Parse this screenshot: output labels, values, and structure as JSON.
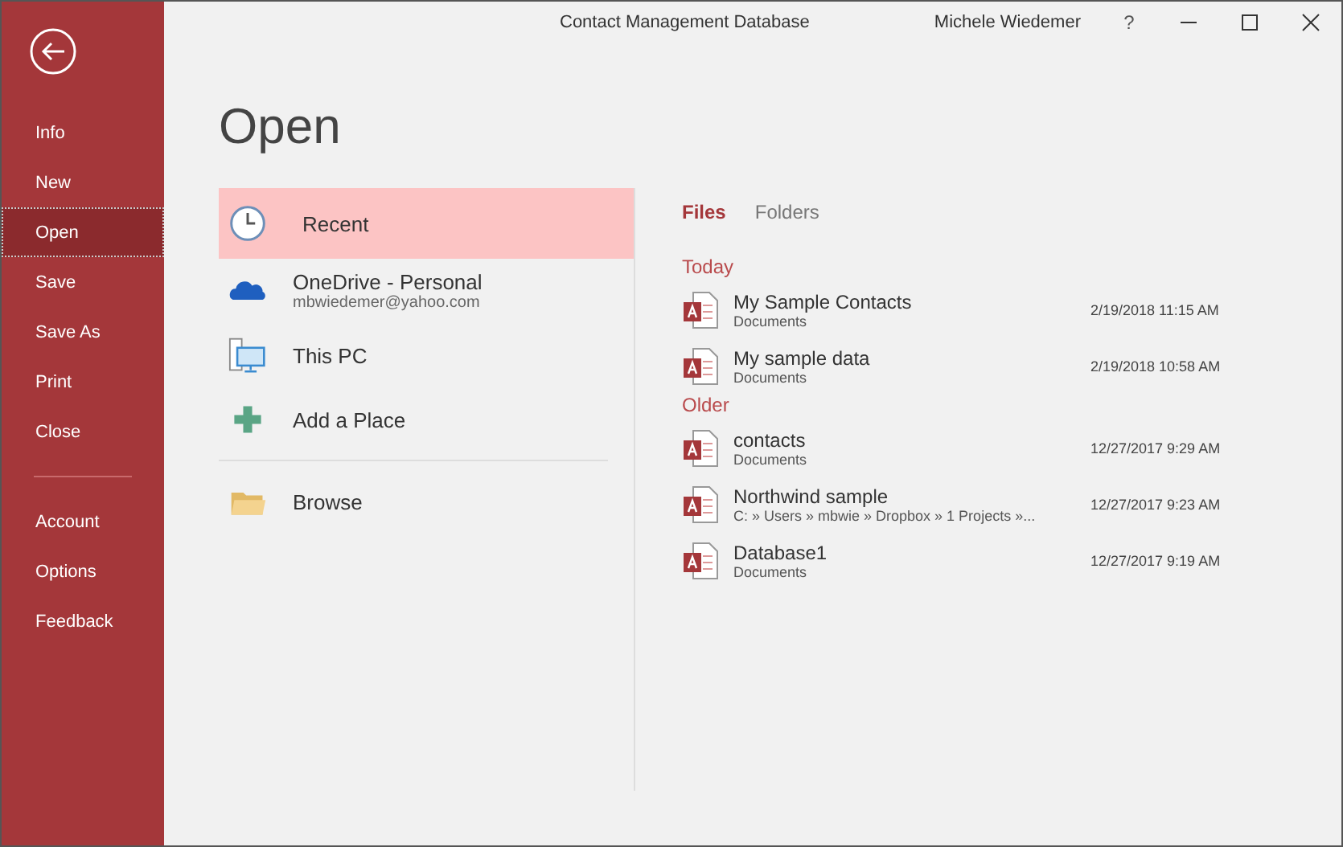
{
  "window": {
    "title": "Contact Management Database",
    "user": "Michele Wiedemer",
    "help": "?"
  },
  "sidebar": {
    "groups": [
      {
        "items": [
          {
            "label": "Info",
            "selected": false
          },
          {
            "label": "New",
            "selected": false
          },
          {
            "label": "Open",
            "selected": true
          },
          {
            "label": "Save",
            "selected": false
          },
          {
            "label": "Save As",
            "selected": false
          },
          {
            "label": "Print",
            "selected": false
          },
          {
            "label": "Close",
            "selected": false
          }
        ]
      },
      {
        "items": [
          {
            "label": "Account",
            "selected": false
          },
          {
            "label": "Options",
            "selected": false
          },
          {
            "label": "Feedback",
            "selected": false
          }
        ]
      }
    ]
  },
  "heading": "Open",
  "places": {
    "groups": [
      {
        "items": [
          {
            "kind": "clock",
            "label": "Recent",
            "selected": true
          },
          {
            "kind": "cloud",
            "label": "OneDrive - Personal",
            "detail": "mbwiedemer@yahoo.com",
            "selected": false
          },
          {
            "kind": "pc",
            "label": "This PC",
            "selected": false
          },
          {
            "kind": "plus",
            "label": "Add a Place",
            "selected": false
          }
        ]
      },
      {
        "items": [
          {
            "kind": "folder",
            "label": "Browse",
            "selected": false
          }
        ]
      }
    ]
  },
  "tabs": [
    {
      "label": "Files",
      "selected": true
    },
    {
      "label": "Folders",
      "selected": false
    }
  ],
  "sections": [
    {
      "title": "Today",
      "files": [
        {
          "name": "My Sample Contacts",
          "location": "Documents",
          "date": "2/19/2018 11:15 AM"
        },
        {
          "name": "My sample data",
          "location": "Documents",
          "date": "2/19/2018 10:58 AM"
        }
      ]
    },
    {
      "title": "Older",
      "files": [
        {
          "name": "contacts",
          "location": "Documents",
          "date": "12/27/2017 9:29 AM"
        },
        {
          "name": "Northwind sample",
          "location": "C: » Users » mbwie » Dropbox » 1 Projects »...",
          "date": "12/27/2017 9:23 AM"
        },
        {
          "name": "Database1",
          "location": "Documents",
          "date": "12/27/2017 9:19 AM"
        }
      ]
    }
  ]
}
